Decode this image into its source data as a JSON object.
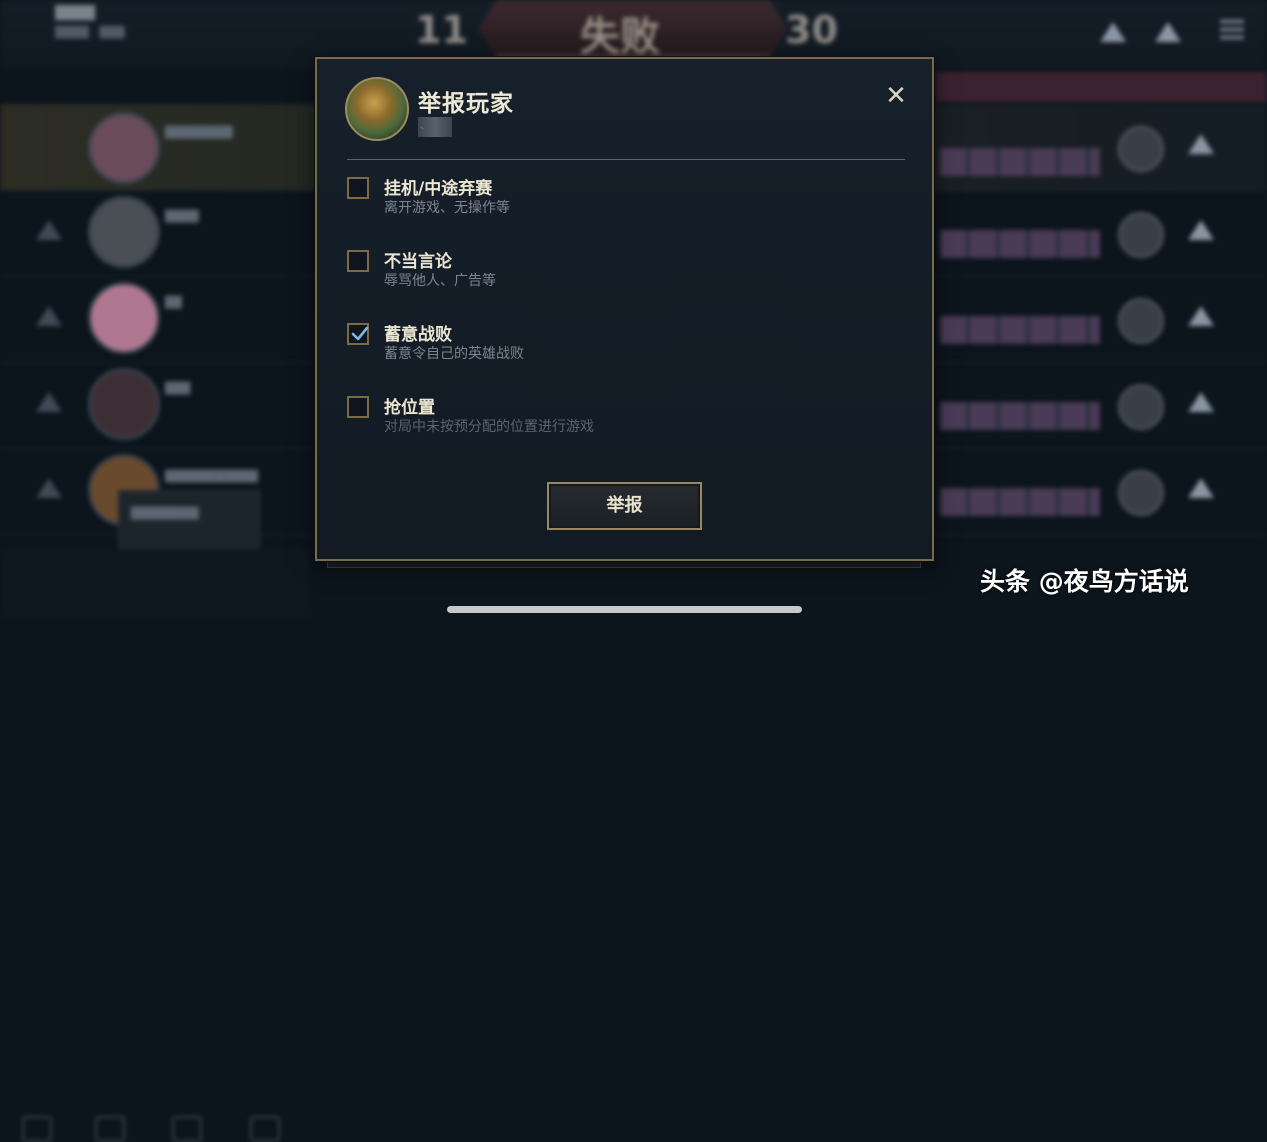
{
  "background": {
    "title": "████",
    "subtitle": "████ · ███",
    "score_left": "11",
    "result": "失败",
    "score_right": "30",
    "player_names": [
      "████████",
      "████",
      "██",
      "███",
      "███████████"
    ],
    "popup_text": "████████"
  },
  "dialog": {
    "title": "举报玩家",
    "player_id": "、",
    "close_icon": "✕",
    "options": [
      {
        "label": "挂机/中途弃赛",
        "desc": "离开游戏、无操作等",
        "checked": false
      },
      {
        "label": "不当言论",
        "desc": "辱骂他人、广告等",
        "checked": false
      },
      {
        "label": "蓄意战败",
        "desc": "蓄意令自己的英雄战败",
        "checked": true
      },
      {
        "label": "抢位置",
        "desc": "对局中未按预分配的位置进行游戏",
        "checked": false
      }
    ],
    "report_button": "举报"
  },
  "watermark": "头条 @夜鸟方话说",
  "colors": {
    "dialog_border": "#7a6a48",
    "checkmark": "#7ab8e8",
    "dialog_bg": "#16202a"
  }
}
